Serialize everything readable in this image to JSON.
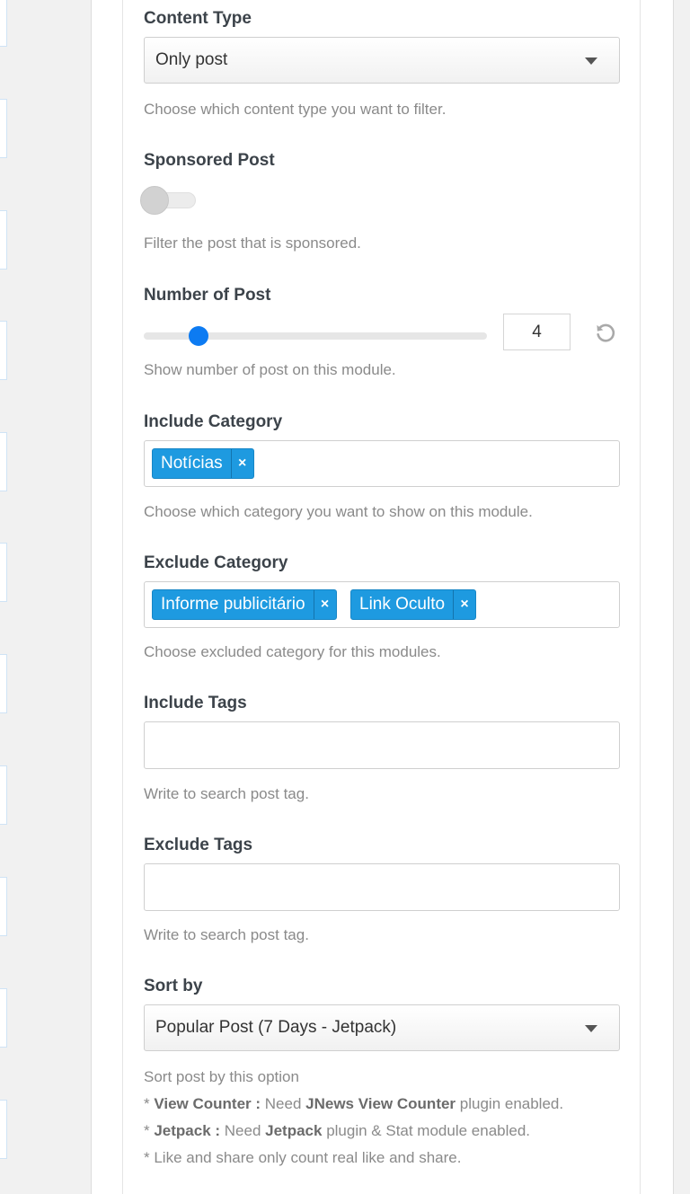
{
  "content_type": {
    "label": "Content Type",
    "value": "Only post",
    "description": "Choose which content type you want to filter."
  },
  "sponsored_post": {
    "label": "Sponsored Post",
    "enabled": false,
    "description": "Filter the post that is sponsored."
  },
  "number_of_post": {
    "label": "Number of Post",
    "value": "4",
    "slider_fraction": 0.13,
    "description": "Show number of post on this module."
  },
  "include_category": {
    "label": "Include Category",
    "tags": [
      "Notícias"
    ],
    "remove_symbol": "×",
    "description": "Choose which category you want to show on this module."
  },
  "exclude_category": {
    "label": "Exclude Category",
    "tags": [
      "Informe publicitário",
      "Link Oculto"
    ],
    "remove_symbol": "×",
    "description": "Choose excluded category for this modules."
  },
  "include_tags": {
    "label": "Include Tags",
    "value": "",
    "description": "Write to search post tag."
  },
  "exclude_tags": {
    "label": "Exclude Tags",
    "value": "",
    "description": "Write to search post tag."
  },
  "sort_by": {
    "label": "Sort by",
    "value": "Popular Post (7 Days - Jetpack)",
    "description": "Sort post by this option",
    "note_1_prefix": "* ",
    "note_1_bold": "View Counter :",
    "note_1_mid": " Need ",
    "note_1_bold2": "JNews View Counter",
    "note_1_end": " plugin enabled.",
    "note_2_prefix": "* ",
    "note_2_bold": "Jetpack :",
    "note_2_mid": " Need ",
    "note_2_bold2": "Jetpack",
    "note_2_end": " plugin & Stat module enabled.",
    "note_3": "* Like and share only count real like and share."
  },
  "icons": {
    "dropdown": "chevron-down-icon",
    "reset": "reset-icon",
    "remove": "close-icon"
  },
  "colors": {
    "accent": "#1e9ae0",
    "slider": "#0d7bf2"
  }
}
